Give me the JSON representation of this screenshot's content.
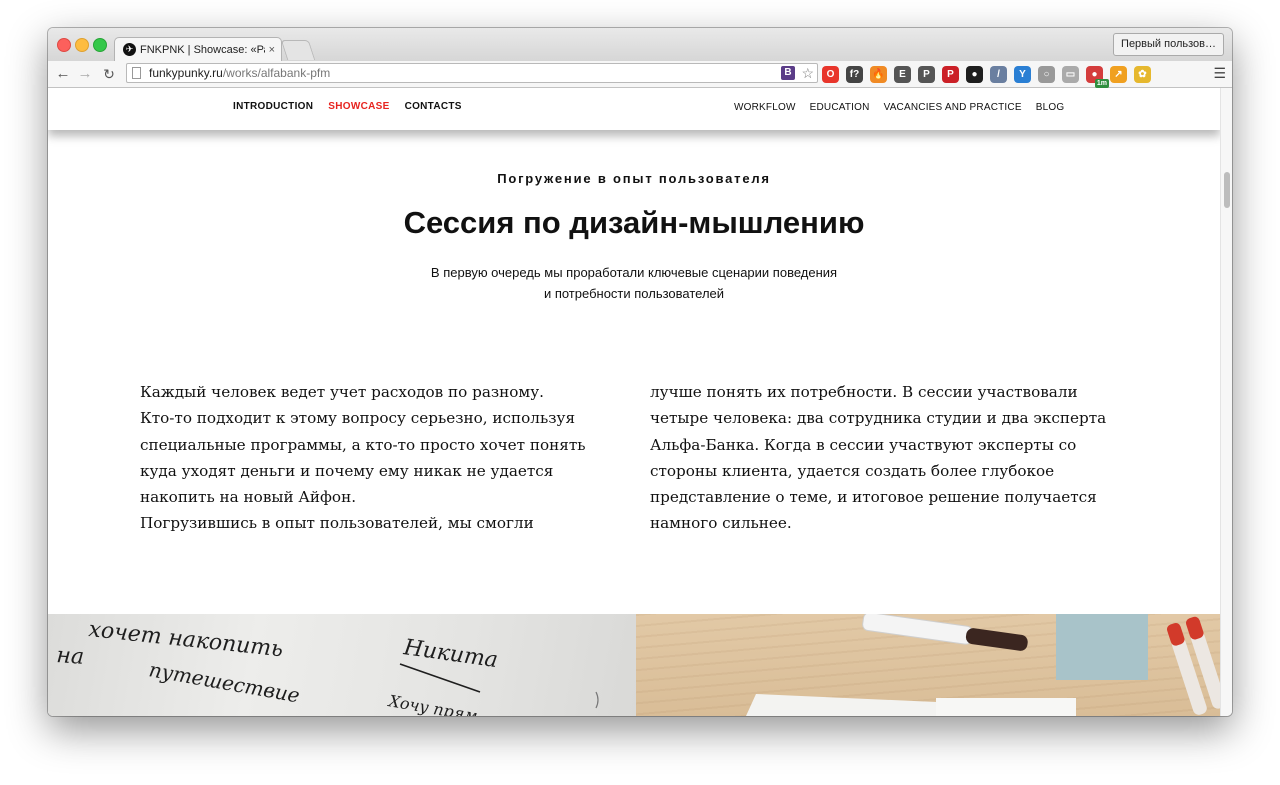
{
  "browser": {
    "tab_title": "FNKPNK | Showcase: «Рас",
    "tab_close": "×",
    "profile_button": "Первый пользов…",
    "url_host": "funkypunky.ru",
    "url_path": "/works/alfabank-pfm",
    "extensions": [
      {
        "name": "opera-ext",
        "glyph": "O",
        "color": "#e8352b"
      },
      {
        "name": "font-finder-ext",
        "glyph": "f?",
        "color": "#444444"
      },
      {
        "name": "fire-ext",
        "glyph": "🔥",
        "color": "#f08a24"
      },
      {
        "name": "evernote-ext",
        "glyph": "E",
        "color": "#555555"
      },
      {
        "name": "pocket-ext",
        "glyph": "P",
        "color": "#555555"
      },
      {
        "name": "pinterest-ext",
        "glyph": "P",
        "color": "#cb2027"
      },
      {
        "name": "camera-ext",
        "glyph": "●",
        "color": "#1e1e1e"
      },
      {
        "name": "eyedropper-ext",
        "glyph": "/",
        "color": "#6a7fa0"
      },
      {
        "name": "y-ext",
        "glyph": "Y",
        "color": "#2a7fd4"
      },
      {
        "name": "ring-ext",
        "glyph": "○",
        "color": "#999999"
      },
      {
        "name": "reader-ext",
        "glyph": "▭",
        "color": "#aaaaaa"
      },
      {
        "name": "timer-ext",
        "glyph": "●",
        "color": "#d43c3c",
        "badge": "1m"
      },
      {
        "name": "chart-ext",
        "glyph": "↗",
        "color": "#f0a020"
      },
      {
        "name": "flower-ext",
        "glyph": "✿",
        "color": "#e6b82e"
      }
    ]
  },
  "nav": {
    "left": [
      {
        "label": "INTRODUCTION",
        "active": false
      },
      {
        "label": "SHOWCASE",
        "active": true
      },
      {
        "label": "CONTACTS",
        "active": false
      }
    ],
    "right": [
      "WORKFLOW",
      "EDUCATION",
      "VACANCIES AND PRACTICE",
      "BLOG"
    ]
  },
  "section": {
    "kicker": "Погружение в опыт пользователя",
    "title": "Сессия по дизайн-мышлению",
    "lede": [
      "В первую очередь мы проработали ключевые сценарии поведения",
      "и потребности пользователей"
    ]
  },
  "body": {
    "left_lines": [
      "Каждый человек ведет учет расходов по разному.",
      "Кто-то подходит к этому вопросу серьезно, используя",
      "специальные программы, а кто-то просто хочет понять",
      "куда уходят деньги и почему ему никак не удается",
      "накопить на новый Айфон.",
      "Погрузившись в опыт пользователей, мы смогли"
    ],
    "right_lines": [
      "лучше понять их потребности. В сессии участвовали",
      "четыре человека: два сотрудника студии и два эксперта",
      "Альфа-Банка. Когда в сессии участвуют эксперты со",
      "стороны клиента, удается создать более глубокое",
      "представление о теме, и итоговое решение получается",
      "намного сильнее."
    ]
  },
  "photos": {
    "whiteboard_words": [
      "хочет накопить",
      "на",
      "путешествие",
      "Никита",
      "Хочу прям"
    ]
  }
}
